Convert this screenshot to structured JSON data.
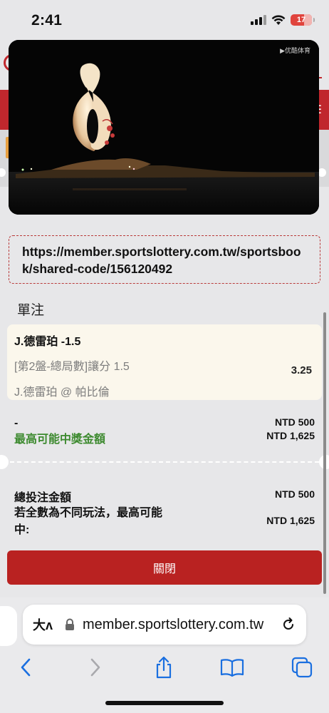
{
  "status": {
    "time": "2:41",
    "battery": "17"
  },
  "video": {
    "watermark": "▶优酷体育"
  },
  "share": {
    "url": "https://member.sportslottery.com.tw/sportsbook/shared-code/156120492"
  },
  "slip": {
    "section_title": "單注",
    "bet": {
      "selection": "J.德雷珀 -1.5",
      "market": "[第2盤-總局數]讓分 1.5",
      "match": "J.德雷珀 @ 帕比倫",
      "odds": "3.25"
    },
    "stake_label": "-",
    "stake_amount": "NTD 500",
    "max_payout_label": "最高可能中獎金額",
    "max_payout_amount": "NTD 1,625",
    "total_stake_label": "總投注金額",
    "total_stake_amount": "NTD 500",
    "potential_label": "若全數為不同玩法，最高可能中:",
    "potential_amount": "NTD 1,625",
    "close_label": "關閉"
  },
  "safari": {
    "aa_label": "大ʌ",
    "url": "member.sportslottery.com.tw"
  }
}
